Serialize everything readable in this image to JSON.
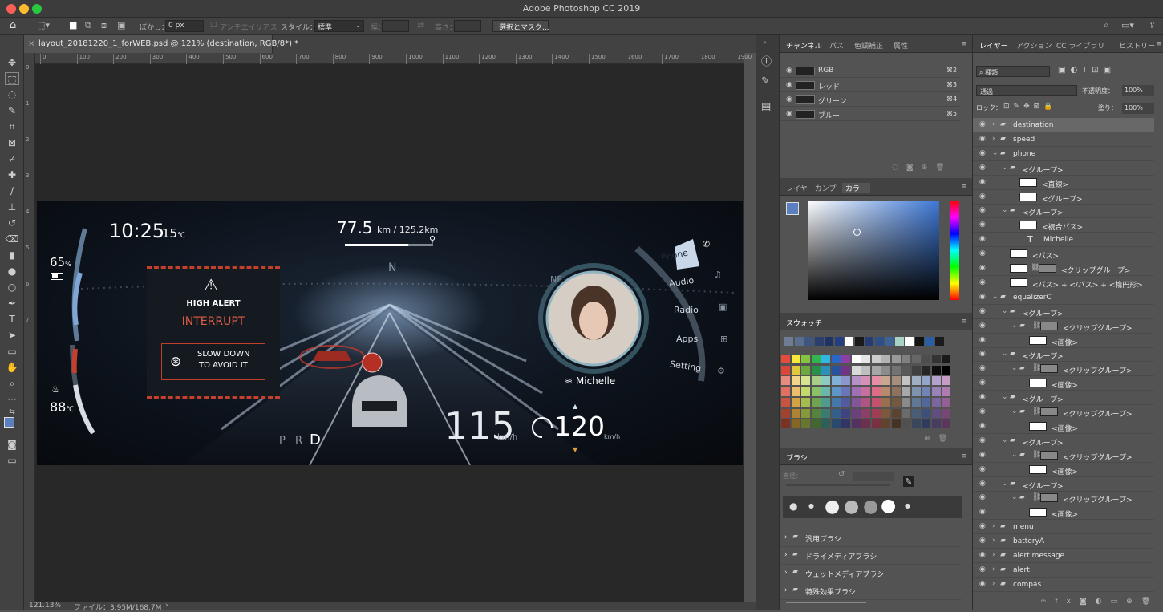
{
  "app": {
    "title": "Adobe Photoshop CC 2019"
  },
  "options": {
    "feather_label": "ぼかし：",
    "feather_value": "0 px",
    "antialias": "アンチエイリアス",
    "style_label": "スタイル：",
    "style_value": "標準",
    "width_label": "幅：",
    "height_label": "高さ：",
    "select_mask": "選択とマスク..."
  },
  "document": {
    "tab_title": "layout_20181220_1_forWEB.psd @ 121% (destination, RGB/8*) *",
    "ruler_marks": [
      "0",
      "100",
      "200",
      "300",
      "400",
      "500",
      "600",
      "700",
      "800",
      "900",
      "1000",
      "1100",
      "1200",
      "1300",
      "1400",
      "1500",
      "1600",
      "1700",
      "1800",
      "1900"
    ],
    "ruler_v_marks": [
      "0",
      "1",
      "2",
      "3",
      "4",
      "5",
      "6",
      "7"
    ]
  },
  "status": {
    "zoom": "121.13%",
    "file": "ファイル：3.95M/168.7M"
  },
  "dashboard": {
    "time": "10:25",
    "temp": "15",
    "temp_unit": "℃",
    "battery": "65",
    "battery_unit": "%",
    "water_temp": "88",
    "water_unit": "℃",
    "distance": "77.5",
    "distance_detail": "km / 125.2km",
    "compass_n": "N",
    "compass_ne": "NE",
    "alert_title": "HIGH ALERT",
    "alert_type": "INTERRUPT",
    "alert_msg1": "SLOW DOWN",
    "alert_msg2": "TO AVOID IT",
    "gear_pr": "P R",
    "gear_d": "D",
    "speed": "115",
    "speed_unit": "km/h",
    "limit": "120",
    "limit_unit": "km/h",
    "caller": "Michelle",
    "menu": [
      "Phone",
      "Audio",
      "Radio",
      "Apps",
      "Setting"
    ],
    "distance_progress": 0.72
  },
  "channels": {
    "tabs": [
      "チャンネル",
      "パス",
      "色調補正",
      "属性"
    ],
    "rows": [
      {
        "name": "RGB",
        "key": "⌘2"
      },
      {
        "name": "レッド",
        "key": "⌘3"
      },
      {
        "name": "グリーン",
        "key": "⌘4"
      },
      {
        "name": "ブルー",
        "key": "⌘5"
      }
    ]
  },
  "color": {
    "tabs": [
      "レイヤーカンプ",
      "カラー"
    ],
    "fg": "#5b7fbf"
  },
  "swatches": {
    "tab": "スウォッチ",
    "top_row": [
      "#6e7d94",
      "#5a6e8e",
      "#3f5680",
      "#2a3f6e",
      "#1e3266",
      "#243f7f",
      "#ffffff",
      "#1a1a1a",
      "#263c73",
      "#2f4f86",
      "#3d6296",
      "#a8d3c3",
      "#ffffff",
      "#131313",
      "#2c5ea6",
      "#1b1b1b"
    ],
    "grid": [
      [
        "#e64b3c",
        "#f5ea3a",
        "#85c341",
        "#31b54c",
        "#30b7e6",
        "#2a68c7",
        "#8e3ea6",
        "#ffffff",
        "#e6e6e6",
        "#cccccc",
        "#b3b3b3",
        "#999999",
        "#808080",
        "#666666",
        "#4d4d4d",
        "#333333",
        "#1a1a1a"
      ],
      [
        "#d9463a",
        "#e1c83b",
        "#6ea840",
        "#2a8f48",
        "#2b91b8",
        "#28529e",
        "#733486",
        "#d9d9d9",
        "#bfbfbf",
        "#a6a6a6",
        "#8c8c8c",
        "#737373",
        "#595959",
        "#404040",
        "#262626",
        "#0d0d0d",
        "#000000"
      ],
      [
        "#e78c7f",
        "#f2d48a",
        "#d7e38f",
        "#a8cf87",
        "#8bcbc1",
        "#82b1d8",
        "#8d95cf",
        "#b690c8",
        "#d592b6",
        "#e78ea7",
        "#c9a68e",
        "#a58f7c",
        "#c3c3c3",
        "#9fb0c5",
        "#93a6c9",
        "#b3a2cb",
        "#c79cc4"
      ],
      [
        "#e0705f",
        "#eebd6b",
        "#c3d96c",
        "#8cc068",
        "#68b8ab",
        "#5c97c8",
        "#6c74ba",
        "#a070b6",
        "#c96f9d",
        "#de6c89",
        "#b68a6b",
        "#8f725b",
        "#a8a8a8",
        "#7d93b0",
        "#6f85b6",
        "#9783b8",
        "#b07bae"
      ],
      [
        "#c75441",
        "#d4a245",
        "#a5bd4e",
        "#6fa34f",
        "#4e9b8f",
        "#4579ac",
        "#535aa0",
        "#83569b",
        "#ae5582",
        "#c3526d",
        "#9a6f4f",
        "#745840",
        "#8a8a8a",
        "#607795",
        "#52679b",
        "#7a679d",
        "#955f93"
      ],
      [
        "#a1412f",
        "#ad8333",
        "#85993b",
        "#56843d",
        "#3b7b71",
        "#345f8b",
        "#404380",
        "#6a417c",
        "#8c4066",
        "#9d3e55",
        "#7c583c",
        "#5b432f",
        "#6b6b6b",
        "#4a5d77",
        "#3f4f7b",
        "#5f4e7e",
        "#784875"
      ],
      [
        "#7d3122",
        "#876525",
        "#67772d",
        "#43682f",
        "#2d6058",
        "#284a6d",
        "#313465",
        "#533262",
        "#6d3150",
        "#7b3042",
        "#61432e",
        "#463323",
        "#505050",
        "#38475b",
        "#303c5f",
        "#483c61",
        "#5d375b"
      ]
    ]
  },
  "brush": {
    "tab": "ブラシ",
    "size_label": "直径：",
    "folders": [
      "汎用ブラシ",
      "ドライメディアブラシ",
      "ウェットメディアブラシ",
      "特殊効果ブラシ"
    ]
  },
  "layers": {
    "tabs": [
      "レイヤー",
      "アクション",
      "CC ライブラリ",
      "ヒストリー"
    ],
    "kind": "種類",
    "blend": "通過",
    "opacity_label": "不透明度：",
    "opacity": "100%",
    "lock_label": "ロック：",
    "fill_label": "塗り：",
    "fill": "100%",
    "items": [
      {
        "name": "destination",
        "type": "group",
        "arrow": "›",
        "indent": 0,
        "sel": true
      },
      {
        "name": "speed",
        "type": "group",
        "arrow": "›",
        "indent": 0
      },
      {
        "name": "phone",
        "type": "group",
        "arrow": "⌄",
        "indent": 0
      },
      {
        "name": "<グループ>",
        "type": "group",
        "arrow": "⌄",
        "indent": 1
      },
      {
        "name": "<直線>",
        "type": "shape",
        "indent": 2
      },
      {
        "name": "<グループ>",
        "type": "shape",
        "indent": 2
      },
      {
        "name": "<グループ>",
        "type": "group",
        "arrow": "⌄",
        "indent": 1
      },
      {
        "name": "<複合パス>",
        "type": "shape",
        "indent": 2
      },
      {
        "name": "Michelle",
        "type": "text",
        "indent": 2
      },
      {
        "name": "<パス>",
        "type": "shape",
        "indent": 1
      },
      {
        "name": "<クリップグループ>",
        "type": "clip",
        "indent": 1
      },
      {
        "name": "<パス> + </パス> + <楕円形>",
        "type": "shape",
        "indent": 1
      },
      {
        "name": "equalizerC",
        "type": "group",
        "arrow": "⌄",
        "indent": 0
      },
      {
        "name": "<グループ>",
        "type": "group",
        "arrow": "⌄",
        "indent": 1
      },
      {
        "name": "<クリップグループ>",
        "type": "clipgroup",
        "arrow": "⌄",
        "indent": 2
      },
      {
        "name": "<画像>",
        "type": "image",
        "indent": 3
      },
      {
        "name": "<グループ>",
        "type": "group",
        "arrow": "⌄",
        "indent": 1
      },
      {
        "name": "<クリップグループ>",
        "type": "clipgroup",
        "arrow": "⌄",
        "indent": 2
      },
      {
        "name": "<画像>",
        "type": "image",
        "indent": 3
      },
      {
        "name": "<グループ>",
        "type": "group",
        "arrow": "⌄",
        "indent": 1
      },
      {
        "name": "<クリップグループ>",
        "type": "clipgroup",
        "arrow": "⌄",
        "indent": 2
      },
      {
        "name": "<画像>",
        "type": "image",
        "indent": 3
      },
      {
        "name": "<グループ>",
        "type": "group",
        "arrow": "⌄",
        "indent": 1
      },
      {
        "name": "<クリップグループ>",
        "type": "clipgroup",
        "arrow": "⌄",
        "indent": 2
      },
      {
        "name": "<画像>",
        "type": "image",
        "indent": 3
      },
      {
        "name": "<グループ>",
        "type": "group",
        "arrow": "⌄",
        "indent": 1
      },
      {
        "name": "<クリップグループ>",
        "type": "clipgroup",
        "arrow": "⌄",
        "indent": 2
      },
      {
        "name": "<画像>",
        "type": "image",
        "indent": 3
      },
      {
        "name": "menu",
        "type": "group",
        "arrow": "›",
        "indent": 0
      },
      {
        "name": "batteryA",
        "type": "group",
        "arrow": "›",
        "indent": 0
      },
      {
        "name": "alert message",
        "type": "group",
        "arrow": "›",
        "indent": 0
      },
      {
        "name": "alert",
        "type": "group",
        "arrow": "›",
        "indent": 0
      },
      {
        "name": "compas",
        "type": "group",
        "arrow": "›",
        "indent": 0
      }
    ]
  }
}
